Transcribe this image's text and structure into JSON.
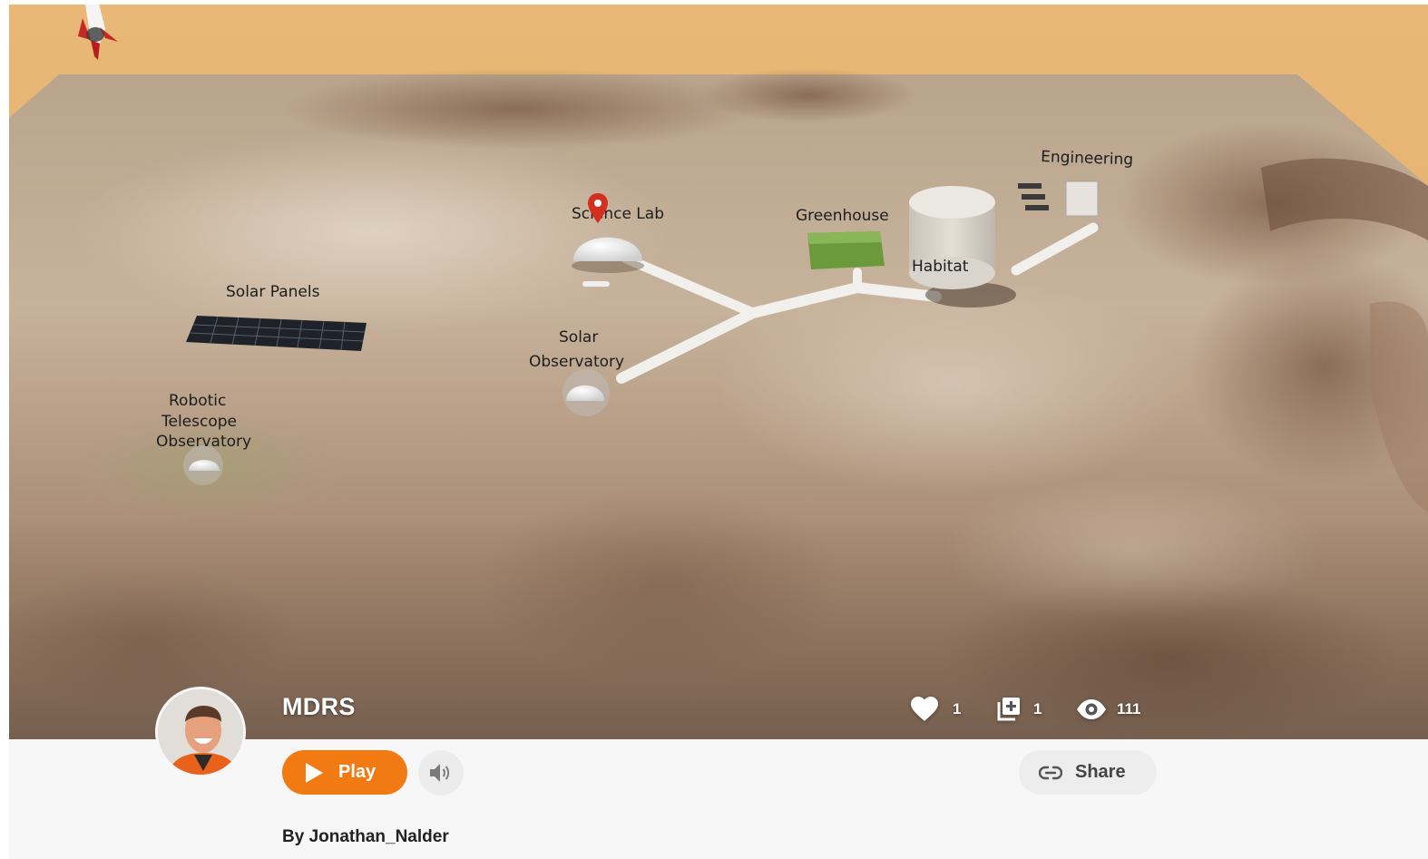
{
  "scene": {
    "labels": {
      "science_lab": "Science Lab",
      "greenhouse": "Greenhouse",
      "engineering": "Engineering",
      "habitat": "Habitat",
      "solar_panels": "Solar Panels",
      "solar_observatory_1": "Solar",
      "solar_observatory_2": "Observatory",
      "robotic_1": "Robotic",
      "robotic_2": "Telescope",
      "robotic_3": "Observatory"
    },
    "colors": {
      "sand": "#e2ae6e",
      "pin": "#d32f1f",
      "greenhouse": "#6a9a3c"
    }
  },
  "tour": {
    "title": "MDRS",
    "likes": "1",
    "collects": "1",
    "views": "111",
    "play_label": "Play",
    "share_label": "Share",
    "author": "By Jonathan_Nalder"
  },
  "icons": {
    "likes": "heart-icon",
    "collects": "add-to-collection-icon",
    "views": "eye-icon",
    "play": "play-triangle-icon",
    "sound": "speaker-icon",
    "share": "link-icon",
    "pin": "map-pin-icon",
    "rocket": "rocket-icon"
  },
  "theme": {
    "accent": "#f27a12",
    "bar_bg": "#f7f7f7",
    "button_bg": "#ececec"
  }
}
